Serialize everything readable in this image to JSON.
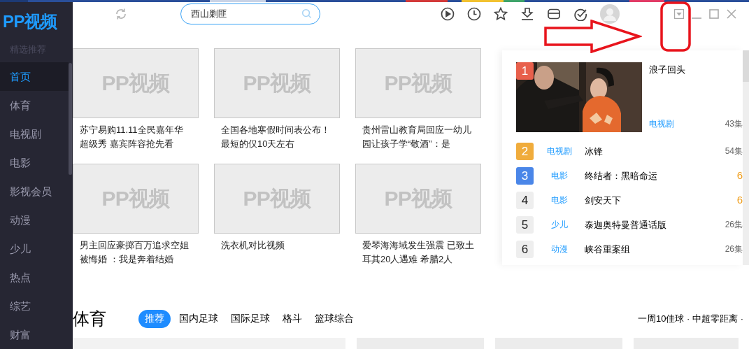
{
  "sidebar": {
    "logo": "PP视频",
    "section_label": "精选推荐",
    "items": [
      {
        "label": "首页",
        "selected": true
      },
      {
        "label": "体育",
        "selected": false
      },
      {
        "label": "电视剧",
        "selected": false
      },
      {
        "label": "电影",
        "selected": false
      },
      {
        "label": "影视会员",
        "selected": false
      },
      {
        "label": "动漫",
        "selected": false
      },
      {
        "label": "少儿",
        "selected": false
      },
      {
        "label": "热点",
        "selected": false
      },
      {
        "label": "综艺",
        "selected": false
      },
      {
        "label": "财富",
        "selected": false
      }
    ]
  },
  "header": {
    "search": {
      "value": "西山剿匪"
    }
  },
  "cards": [
    {
      "thumb_text": "PP视频",
      "title": "苏宁易购11.11全民嘉年华超级秀 嘉宾阵容抢先看"
    },
    {
      "thumb_text": "PP视频",
      "title": "全国各地寒假时间表公布！最短的仅10天左右"
    },
    {
      "thumb_text": "PP视频",
      "title": "贵州雷山教育局回应一幼儿园让孩子学“敬酒”：是"
    },
    {
      "thumb_text": "PP视频",
      "title": "男主回应豪掷百万追求空姐被悔婚 ：我是奔着结婚"
    },
    {
      "thumb_text": "PP视频",
      "title": "洗衣机对比视频"
    },
    {
      "thumb_text": "PP视频",
      "title": "爱琴海海域发生强震 已致土耳其20人遇难 希腊2人"
    }
  ],
  "ranking": {
    "items": [
      {
        "kind": "featured",
        "rank": "1",
        "color": "#e8604c",
        "category": "电视剧",
        "title": "浪子回头",
        "meta": "43集",
        "highlighted": false
      },
      {
        "kind": "row",
        "rank": "2",
        "color": "#f0ac3c",
        "category": "电视剧",
        "title": "冰锋",
        "meta": "54集",
        "highlighted": false
      },
      {
        "kind": "row",
        "rank": "3",
        "color": "#4a86e8",
        "category": "电影",
        "title": "终结者：黑暗命运",
        "meta": "6",
        "highlighted": true
      },
      {
        "kind": "row",
        "rank": "4",
        "color": "#eeeeee",
        "category": "电影",
        "title": "剑安天下",
        "meta": "6",
        "highlighted": true
      },
      {
        "kind": "row",
        "rank": "5",
        "color": "#eeeeee",
        "category": "少儿",
        "title": "泰迦奥特曼普通话版",
        "meta": "26集",
        "highlighted": false
      },
      {
        "kind": "row",
        "rank": "6",
        "color": "#eeeeee",
        "category": "动漫",
        "title": "峡谷重案组",
        "meta": "26集",
        "highlighted": false
      }
    ]
  },
  "sports": {
    "title": "体育",
    "tabs": [
      {
        "label": "推荐",
        "selected": true
      },
      {
        "label": "国内足球",
        "selected": false
      },
      {
        "label": "国际足球",
        "selected": false
      },
      {
        "label": "格斗",
        "selected": false
      },
      {
        "label": "篮球综合",
        "selected": false
      }
    ],
    "links": "一周10佳球 · 中超零距离 ·"
  }
}
